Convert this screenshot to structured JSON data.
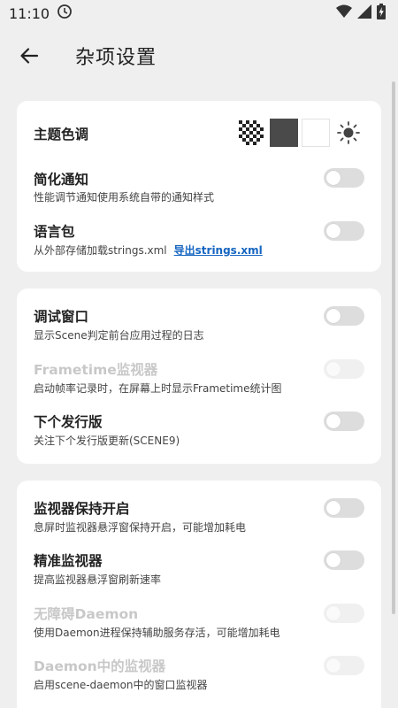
{
  "status": {
    "time": "11:10"
  },
  "header": {
    "title": "杂项设置"
  },
  "theme": {
    "title": "主题色调",
    "swatch_dark": "#4a4a4a",
    "swatch_light": "#ffffff"
  },
  "card1": [
    {
      "title": "简化通知",
      "desc": "性能调节通知使用系统自带的通知样式",
      "enabled": true
    },
    {
      "title": "语言包",
      "desc": "从外部存储加载strings.xml",
      "link": "导出strings.xml",
      "enabled": true
    }
  ],
  "card2": [
    {
      "title": "调试窗口",
      "desc": "显示Scene判定前台应用过程的日志",
      "enabled": true
    },
    {
      "title": "Frametime监视器",
      "desc": "启动帧率记录时，在屏幕上时显示Frametime统计图",
      "enabled": false
    },
    {
      "title": "下个发行版",
      "desc": "关注下个发行版更新(SCENE9)",
      "enabled": true
    }
  ],
  "card3": [
    {
      "title": "监视器保持开启",
      "desc": "息屏时监视器悬浮窗保持开启，可能增加耗电",
      "enabled": true
    },
    {
      "title": "精准监视器",
      "desc": "提高监视器悬浮窗刷新速率",
      "enabled": true
    },
    {
      "title": "无障碍Daemon",
      "desc": "使用Daemon进程保持辅助服务存活，可能增加耗电",
      "enabled": false
    },
    {
      "title": "Daemon中的监视器",
      "desc": "启用scene-daemon中的窗口监视器",
      "enabled": false
    }
  ]
}
